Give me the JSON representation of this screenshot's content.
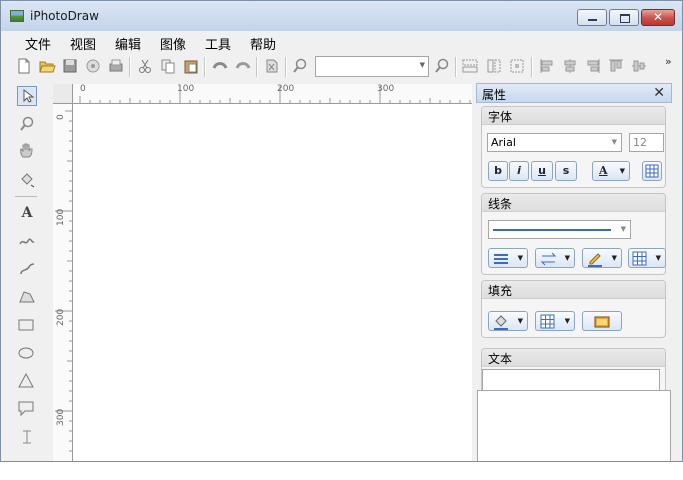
{
  "window": {
    "title": "iPhotoDraw",
    "close_glyph": "✕"
  },
  "menu": [
    "文件",
    "视图",
    "编辑",
    "图像",
    "工具",
    "帮助"
  ],
  "toolbar": {
    "icons": [
      "new-icon",
      "open-icon",
      "save-icon",
      "undo-history-icon",
      "print-icon",
      "cut-icon",
      "copy-icon",
      "paste-icon",
      "undo-icon",
      "redo-icon",
      "clear-icon",
      "zoom-icon"
    ],
    "zoom_value": "",
    "overflow": "»"
  },
  "ruler": {
    "h_labels": [
      "0",
      "100",
      "200",
      "300"
    ],
    "v_labels": [
      "0",
      "100",
      "200",
      "300"
    ]
  },
  "properties": {
    "title": "属性",
    "close": "✕",
    "font_group": {
      "title": "字体",
      "font_name": "Arial",
      "font_size": "12",
      "bold": "b",
      "italic": "i",
      "underline": "u",
      "strike": "s",
      "color_letter": "A"
    },
    "line_group": {
      "title": "线条"
    },
    "fill_group": {
      "title": "填充"
    },
    "text_group": {
      "title": "文本"
    }
  },
  "colors": {
    "title_bar": "#c3d4ea",
    "close_button": "#c75050",
    "accent": "#3a6bc8"
  }
}
